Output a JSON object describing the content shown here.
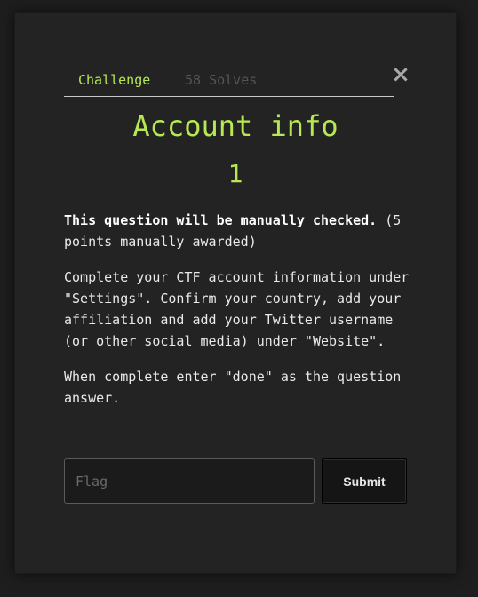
{
  "modal": {
    "close_symbol": "×",
    "tabs": [
      {
        "label": "Challenge",
        "active": true
      },
      {
        "label": "58 Solves",
        "active": false
      }
    ],
    "title": "Account info",
    "value": "1",
    "description": {
      "bold_text": "This question will be manually checked.",
      "points_note": " (5 points manually awarded)",
      "paragraph_2": "Complete your CTF account information under \"Settings\". Confirm your country, add your affiliation and add your Twitter username (or other social media) under \"Website\".",
      "paragraph_3": "When complete enter \"done\" as the question answer."
    },
    "flag_input": {
      "placeholder": "Flag",
      "value": ""
    },
    "submit_label": "Submit"
  },
  "colors": {
    "accent": "#b5e853",
    "background": "#232323",
    "muted": "#555555"
  }
}
